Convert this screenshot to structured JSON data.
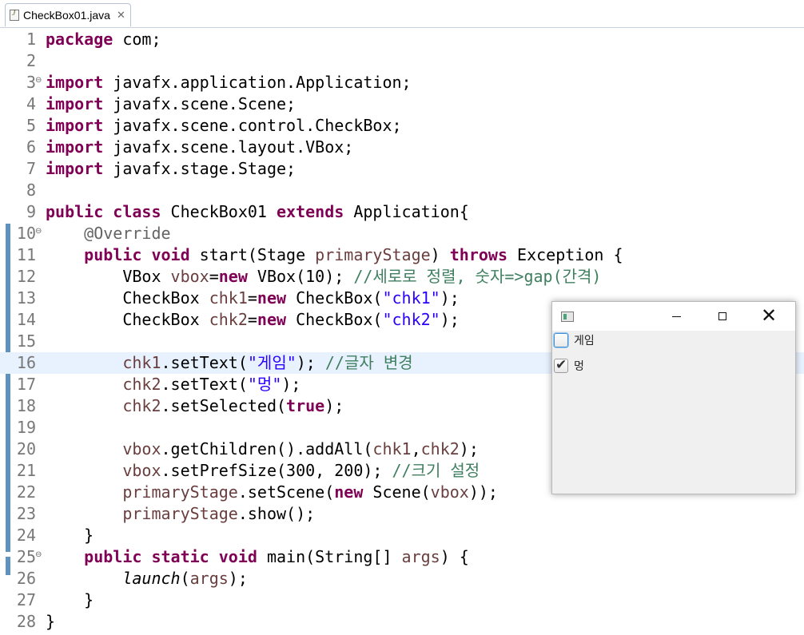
{
  "tab": {
    "title": "CheckBox01.java",
    "close_glyph": "✕"
  },
  "editor": {
    "lines": [
      {
        "n": "1",
        "tokens": [
          {
            "t": "package",
            "c": "kw"
          },
          {
            "t": " com;",
            "c": ""
          }
        ]
      },
      {
        "n": "2",
        "tokens": []
      },
      {
        "n": "3",
        "fold": true,
        "tokens": [
          {
            "t": "import",
            "c": "kw"
          },
          {
            "t": " javafx.application.Application;",
            "c": ""
          }
        ]
      },
      {
        "n": "4",
        "tokens": [
          {
            "t": "import",
            "c": "kw"
          },
          {
            "t": " javafx.scene.Scene;",
            "c": ""
          }
        ]
      },
      {
        "n": "5",
        "tokens": [
          {
            "t": "import",
            "c": "kw"
          },
          {
            "t": " javafx.scene.control.CheckBox;",
            "c": ""
          }
        ]
      },
      {
        "n": "6",
        "tokens": [
          {
            "t": "import",
            "c": "kw"
          },
          {
            "t": " javafx.scene.layout.VBox;",
            "c": ""
          }
        ]
      },
      {
        "n": "7",
        "tokens": [
          {
            "t": "import",
            "c": "kw"
          },
          {
            "t": " javafx.stage.Stage;",
            "c": ""
          }
        ]
      },
      {
        "n": "8",
        "tokens": []
      },
      {
        "n": "9",
        "tokens": [
          {
            "t": "public class",
            "c": "kw"
          },
          {
            "t": " CheckBox01 ",
            "c": ""
          },
          {
            "t": "extends",
            "c": "kw"
          },
          {
            "t": " Application{",
            "c": ""
          }
        ]
      },
      {
        "n": "10",
        "fold": true,
        "tokens": [
          {
            "t": "    ",
            "c": ""
          },
          {
            "t": "@Override",
            "c": "an"
          }
        ]
      },
      {
        "n": "11",
        "tokens": [
          {
            "t": "    ",
            "c": ""
          },
          {
            "t": "public void",
            "c": "kw"
          },
          {
            "t": " start(Stage ",
            "c": ""
          },
          {
            "t": "primaryStage",
            "c": "var"
          },
          {
            "t": ") ",
            "c": ""
          },
          {
            "t": "throws",
            "c": "kw"
          },
          {
            "t": " Exception {",
            "c": ""
          }
        ]
      },
      {
        "n": "12",
        "tokens": [
          {
            "t": "        VBox ",
            "c": ""
          },
          {
            "t": "vbox",
            "c": "var"
          },
          {
            "t": "=",
            "c": ""
          },
          {
            "t": "new",
            "c": "kw"
          },
          {
            "t": " VBox(10); ",
            "c": ""
          },
          {
            "t": "//세로로 정렬, 숫자=>",
            "c": "cm"
          },
          {
            "t": "gap",
            "c": "cm"
          },
          {
            "t": "(간격)",
            "c": "cm"
          }
        ]
      },
      {
        "n": "13",
        "tokens": [
          {
            "t": "        CheckBox ",
            "c": ""
          },
          {
            "t": "chk1",
            "c": "var"
          },
          {
            "t": "=",
            "c": ""
          },
          {
            "t": "new",
            "c": "kw"
          },
          {
            "t": " CheckBox(",
            "c": ""
          },
          {
            "t": "\"chk1\"",
            "c": "str"
          },
          {
            "t": ");",
            "c": ""
          }
        ]
      },
      {
        "n": "14",
        "tokens": [
          {
            "t": "        CheckBox ",
            "c": ""
          },
          {
            "t": "chk2",
            "c": "var"
          },
          {
            "t": "=",
            "c": ""
          },
          {
            "t": "new",
            "c": "kw"
          },
          {
            "t": " CheckBox(",
            "c": ""
          },
          {
            "t": "\"chk2\"",
            "c": "str"
          },
          {
            "t": ");",
            "c": ""
          }
        ]
      },
      {
        "n": "15",
        "tokens": []
      },
      {
        "n": "16",
        "hl": true,
        "tokens": [
          {
            "t": "        ",
            "c": ""
          },
          {
            "t": "chk1",
            "c": "var"
          },
          {
            "t": ".setText(",
            "c": ""
          },
          {
            "t": "\"게임\"",
            "c": "str"
          },
          {
            "t": "); ",
            "c": ""
          },
          {
            "t": "//글자 변경",
            "c": "cm"
          }
        ]
      },
      {
        "n": "17",
        "tokens": [
          {
            "t": "        ",
            "c": ""
          },
          {
            "t": "chk2",
            "c": "var"
          },
          {
            "t": ".setText(",
            "c": ""
          },
          {
            "t": "\"멍\"",
            "c": "str"
          },
          {
            "t": ");",
            "c": ""
          }
        ]
      },
      {
        "n": "18",
        "tokens": [
          {
            "t": "        ",
            "c": ""
          },
          {
            "t": "chk2",
            "c": "var"
          },
          {
            "t": ".setSelected(",
            "c": ""
          },
          {
            "t": "true",
            "c": "kw"
          },
          {
            "t": ");",
            "c": ""
          }
        ]
      },
      {
        "n": "19",
        "tokens": []
      },
      {
        "n": "20",
        "tokens": [
          {
            "t": "        ",
            "c": ""
          },
          {
            "t": "vbox",
            "c": "var"
          },
          {
            "t": ".getChildren().addAll(",
            "c": ""
          },
          {
            "t": "chk1",
            "c": "var"
          },
          {
            "t": ",",
            "c": ""
          },
          {
            "t": "chk2",
            "c": "var"
          },
          {
            "t": ");",
            "c": ""
          }
        ]
      },
      {
        "n": "21",
        "tokens": [
          {
            "t": "        ",
            "c": ""
          },
          {
            "t": "vbox",
            "c": "var"
          },
          {
            "t": ".setPrefSize(300, 200); ",
            "c": ""
          },
          {
            "t": "//크기 설정",
            "c": "cm"
          }
        ]
      },
      {
        "n": "22",
        "tokens": [
          {
            "t": "        ",
            "c": ""
          },
          {
            "t": "primaryStage",
            "c": "var"
          },
          {
            "t": ".setScene(",
            "c": ""
          },
          {
            "t": "new",
            "c": "kw"
          },
          {
            "t": " Scene(",
            "c": ""
          },
          {
            "t": "vbox",
            "c": "var"
          },
          {
            "t": "));",
            "c": ""
          }
        ]
      },
      {
        "n": "23",
        "tokens": [
          {
            "t": "        ",
            "c": ""
          },
          {
            "t": "primaryStage",
            "c": "var"
          },
          {
            "t": ".show();",
            "c": ""
          }
        ]
      },
      {
        "n": "24",
        "tokens": [
          {
            "t": "    }",
            "c": ""
          }
        ]
      },
      {
        "n": "25",
        "fold": true,
        "tokens": [
          {
            "t": "    ",
            "c": ""
          },
          {
            "t": "public static void",
            "c": "kw"
          },
          {
            "t": " main(String[] ",
            "c": ""
          },
          {
            "t": "args",
            "c": "var"
          },
          {
            "t": ") {",
            "c": ""
          }
        ]
      },
      {
        "n": "26",
        "tokens": [
          {
            "t": "        ",
            "c": ""
          },
          {
            "t": "launch",
            "c": "it"
          },
          {
            "t": "(",
            "c": ""
          },
          {
            "t": "args",
            "c": "var"
          },
          {
            "t": ");",
            "c": ""
          }
        ]
      },
      {
        "n": "27",
        "tokens": [
          {
            "t": "    }",
            "c": ""
          }
        ]
      },
      {
        "n": "28",
        "tokens": [
          {
            "t": "}",
            "c": ""
          }
        ]
      }
    ]
  },
  "fx_window": {
    "minimize_label": "",
    "maximize_label": "",
    "close_label": "✕",
    "checkboxes": [
      {
        "label": "게임",
        "checked": false
      },
      {
        "label": "멍",
        "checked": true
      }
    ]
  }
}
